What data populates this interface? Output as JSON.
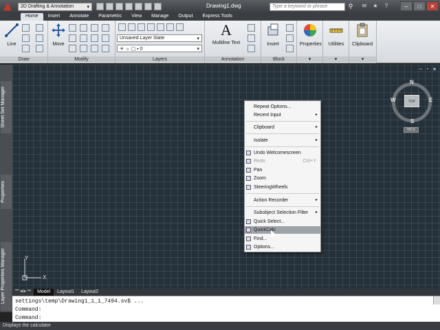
{
  "titlebar": {
    "workspace": "2D Drafting & Annotation",
    "title": "Drawing1.dwg",
    "search_placeholder": "Type a keyword or phrase"
  },
  "tabs": [
    "Home",
    "Insert",
    "Annotate",
    "Parametric",
    "View",
    "Manage",
    "Output",
    "Express Tools"
  ],
  "ribbon": {
    "draw": {
      "title": "Draw",
      "line": "Line"
    },
    "modify": {
      "title": "Modify",
      "move": "Move"
    },
    "layers": {
      "title": "Layers",
      "layer_state": "Unsaved Layer State",
      "current_layer": "0"
    },
    "annotation": {
      "title": "Annotation",
      "mtext": "Multiline Text"
    },
    "block": {
      "title": "Block",
      "insert": "Insert"
    },
    "properties": {
      "label": "Properties"
    },
    "utilities": {
      "label": "Utilities"
    },
    "clipboard": {
      "label": "Clipboard"
    }
  },
  "side_palettes": [
    "Sheet Set Manager",
    "Properties",
    "Layer Properties Manager"
  ],
  "viewcube": {
    "face": "TOP",
    "north": "N",
    "south": "S",
    "east": "E",
    "west": "W",
    "wcs": "WCS"
  },
  "ucs": {
    "x": "X",
    "y": "Y"
  },
  "context_menu": {
    "repeat_options": "Repeat Options...",
    "recent_input": "Recent Input",
    "clipboard": "Clipboard",
    "isolate": "Isolate",
    "undo": "Undo Welcomescreen",
    "redo": "Redo",
    "redo_shortcut": "Ctrl+Y",
    "pan": "Pan",
    "zoom": "Zoom",
    "steeringwheels": "SteeringWheels",
    "action_recorder": "Action Recorder",
    "subobject": "Subobject Selection Filter",
    "quick_select": "Quick Select...",
    "quickcalc": "QuickCalc",
    "find": "Find...",
    "options": "Options..."
  },
  "layout_tabs": [
    "Model",
    "Layout1",
    "Layout2"
  ],
  "command_line": [
    "settings\\temp\\Drawing1_1_1_7494.sv$ ...",
    "Command:",
    "Command:"
  ],
  "status": "Displays the calculator",
  "colors": {
    "canvas": "#253038",
    "ribbon": "#dfe3e8",
    "highlight": "#9ea3a8"
  }
}
